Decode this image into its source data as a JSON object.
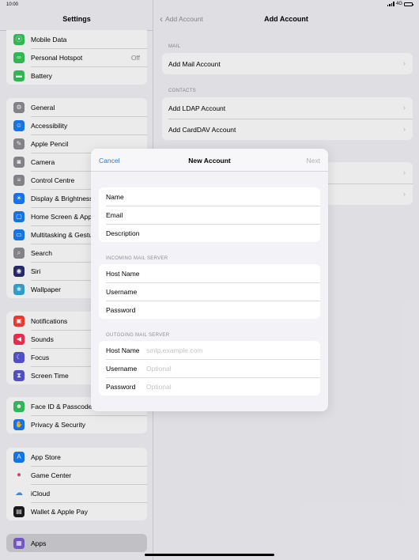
{
  "status": {
    "time": "10:00",
    "network": "4G"
  },
  "sidebar": {
    "title": "Settings",
    "groups": [
      [
        {
          "label": "Mobile Data",
          "icon": "antenna-icon",
          "color": "#34c759",
          "glyph": "⦿"
        },
        {
          "label": "Personal Hotspot",
          "value": "Off",
          "icon": "link-icon",
          "color": "#34c759",
          "glyph": "∞"
        },
        {
          "label": "Battery",
          "icon": "battery-icon",
          "color": "#34c759",
          "glyph": "▬"
        }
      ],
      [
        {
          "label": "General",
          "icon": "gear-icon",
          "color": "#8e8e93",
          "glyph": "⚙"
        },
        {
          "label": "Accessibility",
          "icon": "accessibility-icon",
          "color": "#147efb",
          "glyph": "☺"
        },
        {
          "label": "Apple Pencil",
          "icon": "pencil-icon",
          "color": "#8e8e93",
          "glyph": "✎"
        },
        {
          "label": "Camera",
          "icon": "camera-icon",
          "color": "#8e8e93",
          "glyph": "◙"
        },
        {
          "label": "Control Centre",
          "icon": "control-centre-icon",
          "color": "#8e8e93",
          "glyph": "≡"
        },
        {
          "label": "Display & Brightness",
          "icon": "sun-icon",
          "color": "#147efb",
          "glyph": "☀"
        },
        {
          "label": "Home Screen & App Library",
          "icon": "home-screen-icon",
          "color": "#147efb",
          "glyph": "▢"
        },
        {
          "label": "Multitasking & Gestures",
          "icon": "multitasking-icon",
          "color": "#147efb",
          "glyph": "▭"
        },
        {
          "label": "Search",
          "icon": "search-icon",
          "color": "#8e8e93",
          "glyph": "⌕"
        },
        {
          "label": "Siri",
          "icon": "siri-icon",
          "color": "#2c2c6e",
          "glyph": "◉"
        },
        {
          "label": "Wallpaper",
          "icon": "flower-icon",
          "color": "#34aadc",
          "glyph": "❀"
        }
      ],
      [
        {
          "label": "Notifications",
          "icon": "bell-icon",
          "color": "#ff3b30",
          "glyph": "▣"
        },
        {
          "label": "Sounds",
          "icon": "speaker-icon",
          "color": "#ff2d55",
          "glyph": "◀"
        },
        {
          "label": "Focus",
          "icon": "moon-icon",
          "color": "#5856d6",
          "glyph": "☾"
        },
        {
          "label": "Screen Time",
          "icon": "hourglass-icon",
          "color": "#5856d6",
          "glyph": "⧗"
        }
      ],
      [
        {
          "label": "Face ID & Passcode",
          "icon": "face-id-icon",
          "color": "#34c759",
          "glyph": "☻"
        },
        {
          "label": "Privacy & Security",
          "icon": "hand-icon",
          "color": "#147efb",
          "glyph": "✋"
        }
      ],
      [
        {
          "label": "App Store",
          "icon": "app-store-icon",
          "color": "#147efb",
          "glyph": "A"
        },
        {
          "label": "Game Center",
          "icon": "game-center-icon",
          "color": "#ffffff",
          "glyph": "●"
        },
        {
          "label": "iCloud",
          "icon": "cloud-icon",
          "color": "#ffffff",
          "glyph": "☁"
        },
        {
          "label": "Wallet & Apple Pay",
          "icon": "wallet-icon",
          "color": "#1c1c1e",
          "glyph": "▤"
        }
      ]
    ],
    "apps": {
      "label": "Apps",
      "icon": "apps-icon",
      "color": "#7b5cd6",
      "glyph": "▦"
    }
  },
  "detail": {
    "back_label": "Add Account",
    "title": "Add Account",
    "mail_section": "MAIL",
    "add_mail": "Add Mail Account",
    "contacts_section": "CONTACTS",
    "add_ldap": "Add LDAP Account",
    "add_carddav": "Add CardDAV Account"
  },
  "modal": {
    "cancel": "Cancel",
    "title": "New Account",
    "next": "Next",
    "account_fields": [
      {
        "label": "Name"
      },
      {
        "label": "Email"
      },
      {
        "label": "Description"
      }
    ],
    "incoming_section": "INCOMING MAIL SERVER",
    "incoming_fields": [
      {
        "label": "Host Name",
        "placeholder": ""
      },
      {
        "label": "Username",
        "placeholder": ""
      },
      {
        "label": "Password",
        "placeholder": ""
      }
    ],
    "outgoing_section": "OUTGOING MAIL SERVER",
    "outgoing_fields": [
      {
        "label": "Host Name",
        "placeholder": "smtp.example.com"
      },
      {
        "label": "Username",
        "placeholder": "Optional"
      },
      {
        "label": "Password",
        "placeholder": "Optional"
      }
    ]
  }
}
